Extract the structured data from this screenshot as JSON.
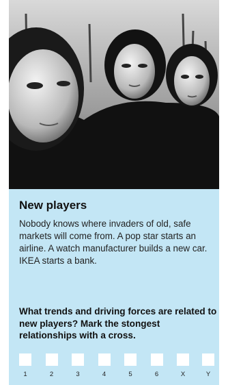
{
  "section": {
    "title": "New players",
    "body": "Nobody knows where invaders of old, safe markets will come from. A pop star starts an airline. A watch manufacturer builds a new car. IKEA starts a bank.",
    "question": "What trends and driving forces are related to new players? Mark the stongest relationships with a cross."
  },
  "checkboxes": [
    {
      "label": "1"
    },
    {
      "label": "2"
    },
    {
      "label": "3"
    },
    {
      "label": "4"
    },
    {
      "label": "5"
    },
    {
      "label": "6"
    },
    {
      "label": "X"
    },
    {
      "label": "Y"
    }
  ],
  "colors": {
    "panel": "#c3e6f5",
    "checkbox": "#ffffff"
  }
}
